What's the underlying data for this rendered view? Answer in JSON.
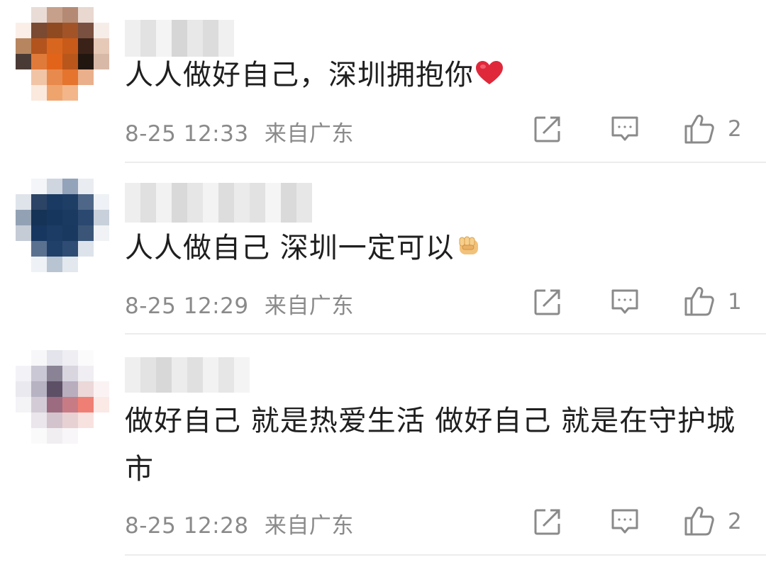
{
  "comments": [
    {
      "text": "人人做好自己，深圳拥抱你",
      "emoji": "red-heart",
      "date": "8-25",
      "time": "12:33",
      "location": "来自广东",
      "likes": "2"
    },
    {
      "text": "人人做自己 深圳一定可以",
      "emoji": "raised-fist",
      "date": "8-25",
      "time": "12:29",
      "location": "来自广东",
      "likes": "1"
    },
    {
      "text": "做好自己 就是热爱生活 做好自己 就是在守护城市",
      "emoji": "",
      "date": "8-25",
      "time": "12:28",
      "location": "来自广东",
      "likes": "2"
    }
  ],
  "icons": {
    "share": "share-icon",
    "reply": "comment-icon",
    "like": "thumbs-up-icon"
  },
  "colors": {
    "text": "#1f1f1f",
    "meta": "#8a8a8a",
    "icon": "#8a8a8a",
    "heart": "#e0283b"
  }
}
